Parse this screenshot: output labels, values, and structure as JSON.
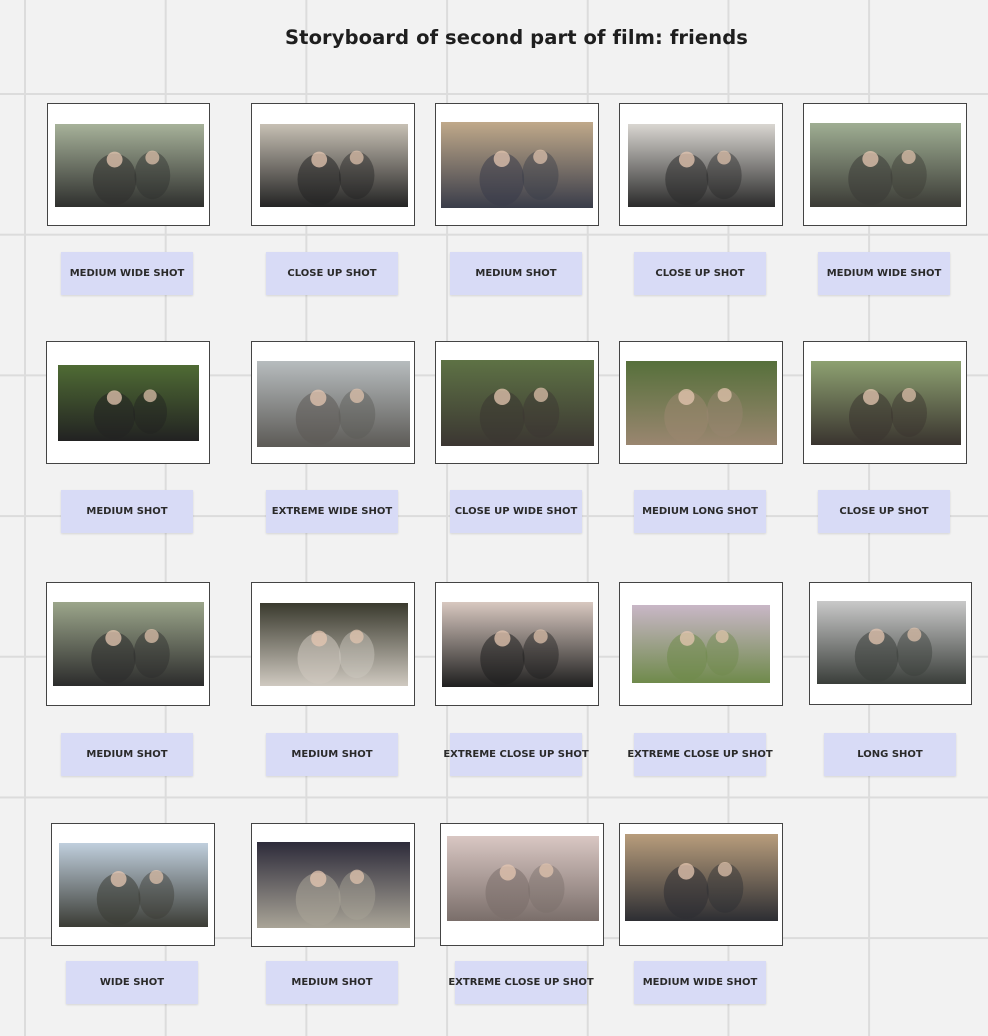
{
  "board": {
    "title": "Storyboard of second part of film: friends"
  },
  "frames": [
    {
      "label": "MEDIUM WIDE SHOT",
      "photo": "living-room-group-photo",
      "tone": [
        "#a7b29a",
        "#2f302e"
      ]
    },
    {
      "label": "CLOSE UP SHOT",
      "photo": "kitchen-cheering-photo",
      "tone": [
        "#c7c0b4",
        "#242424"
      ]
    },
    {
      "label": "MEDIUM SHOT",
      "photo": "dancing-in-room-photo",
      "tone": [
        "#c0a98a",
        "#3a3d4a"
      ]
    },
    {
      "label": "CLOSE UP SHOT",
      "photo": "kiss-on-cheek-photo",
      "tone": [
        "#d9d6d1",
        "#2b2b2b"
      ]
    },
    {
      "label": "MEDIUM WIDE SHOT",
      "photo": "window-group-photo",
      "tone": [
        "#9fae93",
        "#3b3b36"
      ]
    },
    {
      "label": "MEDIUM SHOT",
      "photo": "seated-outdoors-photo",
      "tone": [
        "#4f6b34",
        "#222222"
      ]
    },
    {
      "label": "EXTREME WIDE SHOT",
      "photo": "patio-wide-photo",
      "tone": [
        "#b7bcbe",
        "#5c5a56"
      ]
    },
    {
      "label": "CLOSE UP WIDE SHOT",
      "photo": "toasting-table-photo",
      "tone": [
        "#5e7245",
        "#3b3632"
      ]
    },
    {
      "label": "MEDIUM LONG SHOT",
      "photo": "garden-sofa-photo",
      "tone": [
        "#56703b",
        "#9a8670"
      ]
    },
    {
      "label": "CLOSE UP SHOT",
      "photo": "smiling-friends-photo",
      "tone": [
        "#8ea171",
        "#3a342f"
      ]
    },
    {
      "label": "MEDIUM SHOT",
      "photo": "over-shoulder-photo",
      "tone": [
        "#9ca68b",
        "#2c2c2c"
      ]
    },
    {
      "label": "MEDIUM SHOT",
      "photo": "dark-doorway-photo",
      "tone": [
        "#3a3a2e",
        "#cfc9c0"
      ]
    },
    {
      "label": "EXTREME CLOSE UP SHOT",
      "photo": "lips-closeup-photo",
      "tone": [
        "#d8c8c0",
        "#1f1f1f"
      ]
    },
    {
      "label": "EXTREME CLOSE UP SHOT",
      "photo": "face-blur-closeup-photo",
      "tone": [
        "#c9b7c7",
        "#6f8a4b"
      ]
    },
    {
      "label": "LONG SHOT",
      "photo": "through-doorway-photo",
      "tone": [
        "#c9c9c9",
        "#3a3e3a"
      ]
    },
    {
      "label": "WIDE SHOT",
      "photo": "backyard-wide-photo",
      "tone": [
        "#c0cfdd",
        "#3b3c35"
      ]
    },
    {
      "label": "MEDIUM SHOT",
      "photo": "night-dance-photo",
      "tone": [
        "#2d2b3a",
        "#a9a497"
      ]
    },
    {
      "label": "EXTREME CLOSE UP SHOT",
      "photo": "pout-closeup-photo",
      "tone": [
        "#d9c7c3",
        "#7a6e6a"
      ]
    },
    {
      "label": "MEDIUM WIDE SHOT",
      "photo": "kitchen-wide-photo",
      "tone": [
        "#b89d7c",
        "#2d2e33"
      ]
    }
  ]
}
